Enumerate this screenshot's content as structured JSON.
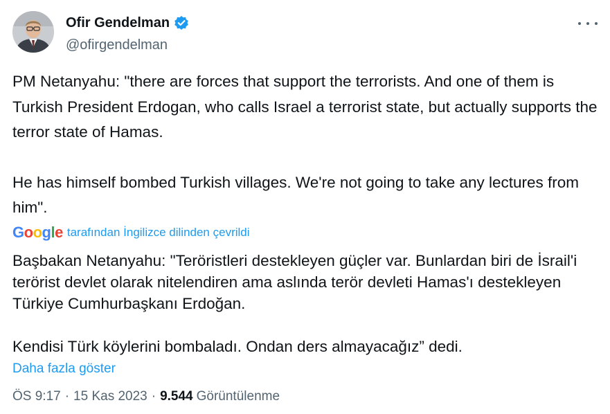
{
  "author": {
    "display_name": "Ofir Gendelman",
    "handle": "@ofirgendelman"
  },
  "tweet": {
    "paragraphs": [
      "PM Netanyahu: \"there are forces that support the terrorists. And one of them is Turkish President Erdogan, who calls Israel a terrorist state, but actually supports the terror state of Hamas.",
      "He has himself bombed Turkish villages. We're not going to take any lectures from him\"."
    ],
    "translation_label": "tarafından İngilizce dilinden çevrildi",
    "google_logo": "Google",
    "translated_paragraphs": [
      "Başbakan Netanyahu: \"Teröristleri destekleyen güçler var. Bunlardan biri de İsrail'i terörist devlet olarak nitelendiren ama aslında terör devleti Hamas'ı destekleyen Türkiye Cumhurbaşkanı Erdoğan.",
      "Kendisi Türk köylerini bombaladı. Ondan ders almayacağız” dedi."
    ],
    "show_more": "Daha fazla göster"
  },
  "meta": {
    "time": "ÖS 9:17",
    "separator": "·",
    "date": "15 Kas 2023",
    "views_count": "9.544",
    "views_label": "Görüntülenme"
  },
  "colors": {
    "text": "#0f1419",
    "secondary": "#536471",
    "link": "#1d9bf0",
    "verified": "#1d9bf0"
  },
  "icons": {
    "verified": "verified-badge-icon",
    "more": "more-horizontal-icon"
  }
}
